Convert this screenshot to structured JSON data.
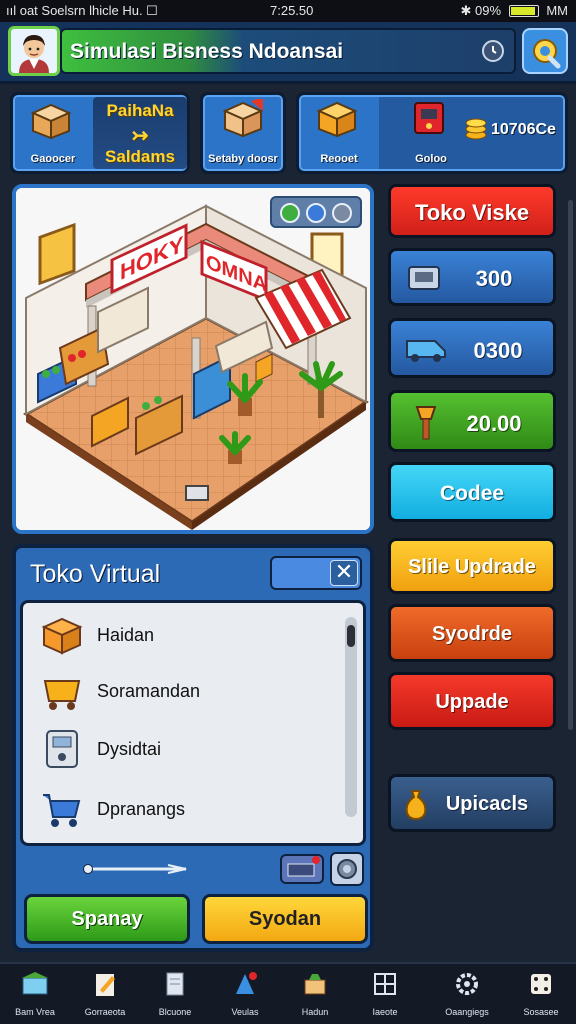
{
  "status_bar": {
    "left": "ııl oat  Soelsrn lhicle   Hu. ☐",
    "time": "7:25.50",
    "right": "09%",
    "right_tail": "MM"
  },
  "header": {
    "title": "Simulasi Bisness Ndoansai"
  },
  "top_cards": [
    {
      "label": "Gaoocer"
    },
    {
      "label": "Setaby doosr"
    },
    {
      "label": "Reooet"
    },
    {
      "label": "Goloo"
    }
  ],
  "card_highlight": {
    "line1": "PaihaNa",
    "line2": "Saldams"
  },
  "coins": "10706Ce",
  "scene": {
    "sign_left": "HOKY",
    "sign_right": "OMNA"
  },
  "right_buttons": [
    {
      "label": "Toko Viske",
      "color": "#e02a20"
    },
    {
      "label": "300",
      "color": "#2b6cb8"
    },
    {
      "label": "0300",
      "color": "#2b6cb8"
    },
    {
      "label": "20.00",
      "color": "#3ea41f"
    },
    {
      "label": "Codee",
      "color": "#1ec1e8"
    },
    {
      "label": "Slile Updrade",
      "color": "#f7b21b"
    },
    {
      "label": "Syodrde",
      "color": "#e2541c"
    },
    {
      "label": "Uppade",
      "color": "#e4271d"
    },
    {
      "label": "Upicacls",
      "color": "#2d4f7a"
    }
  ],
  "shop": {
    "title": "Toko Virtual",
    "close": "✕",
    "items": [
      {
        "label": "Haidan"
      },
      {
        "label": "Soramandan"
      },
      {
        "label": "Dysidtai"
      },
      {
        "label": "Dpranangs"
      }
    ],
    "btn_green": "Spanay",
    "btn_yellow": "Syodan"
  },
  "bottom_nav": [
    {
      "label": "Bam Vrea",
      "icon": "store-icon"
    },
    {
      "label": "Gorraeota",
      "icon": "pencil-icon"
    },
    {
      "label": "Blcuone",
      "icon": "book-icon"
    },
    {
      "label": "Veulas",
      "icon": "bell-icon"
    },
    {
      "label": "Hadun",
      "icon": "box-icon"
    },
    {
      "label": "Iaeote",
      "icon": "grid-icon"
    },
    {
      "label": "Oaangiegs",
      "icon": "gear-icon"
    },
    {
      "label": "Sosasee",
      "icon": "dice-icon"
    }
  ]
}
